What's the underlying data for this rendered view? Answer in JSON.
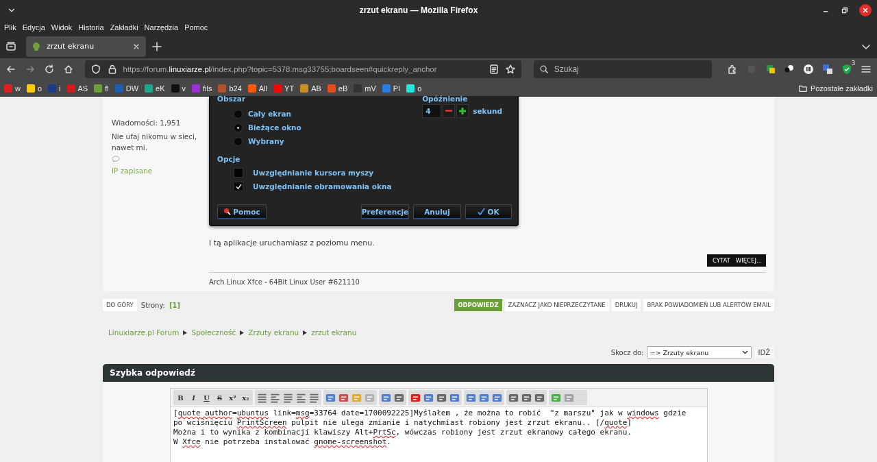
{
  "window": {
    "title": "zrzut ekranu — Mozilla Firefox"
  },
  "menu": [
    "Plik",
    "Edycja",
    "Widok",
    "Historia",
    "Zakładki",
    "Narzędzia",
    "Pomoc"
  ],
  "tabs": [
    {
      "label": "zrzut ekranu",
      "selected": true
    }
  ],
  "address": {
    "scheme": "https://forum.",
    "domain": "linuxiarze.pl",
    "path": "/index.php?topic=5378.msg33755;boardseen#quickreply_anchor"
  },
  "search": {
    "placeholder": "Szukaj"
  },
  "extension_badge": "3",
  "bookmarks": [
    {
      "label": "w",
      "color": "#e02020"
    },
    {
      "label": "o",
      "color": "#ffcc00"
    },
    {
      "label": "i",
      "color": "#1a3a8a"
    },
    {
      "label": "AS",
      "color": "#d01c1c"
    },
    {
      "label": "fl",
      "color": "#6a9f3a"
    },
    {
      "label": "DW",
      "color": "#1a5fb4"
    },
    {
      "label": "eK",
      "color": "#1aa88a"
    },
    {
      "label": "v",
      "color": "#111111"
    },
    {
      "label": "fils",
      "color": "#9b30d9"
    },
    {
      "label": "b24",
      "color": "#b0532a"
    },
    {
      "label": "All",
      "color": "#ff5a00"
    },
    {
      "label": "YT",
      "color": "#ff0000"
    },
    {
      "label": "AB",
      "color": "#c89020"
    },
    {
      "label": "eB",
      "color": "#e64a19"
    },
    {
      "label": "mV",
      "color": "#333333"
    },
    {
      "label": "PI",
      "color": "#2a7be4"
    },
    {
      "label": "o",
      "color": "#23e5db"
    }
  ],
  "other_bookmarks": "Pozostałe zakładki",
  "post": {
    "author_info": [
      "Wiadomości: 1,951",
      "Nie ufaj nikomu w sieci, nawet mi."
    ],
    "ip": "IP zapisane",
    "dialog": {
      "area_label": "Obszar",
      "areas": [
        {
          "label": "Cały ekran",
          "selected": false
        },
        {
          "label": "Bieżące okno",
          "selected": true
        },
        {
          "label": "Wybrany",
          "selected": false
        }
      ],
      "delay_label": "Opóźnienie",
      "delay_value": "4",
      "delay_unit": "sekund",
      "options_label": "Opcje",
      "options": [
        {
          "label": "Uwzględnianie kursora myszy",
          "checked": false
        },
        {
          "label": "Uwzględnianie obramowania okna",
          "checked": true
        }
      ],
      "buttons": [
        {
          "label": "Pomoc",
          "kind": "help"
        },
        {
          "label": "Preferencje",
          "kind": "plain"
        },
        {
          "label": "Anuluj",
          "kind": "plain"
        },
        {
          "label": "OK",
          "kind": "ok"
        }
      ]
    },
    "body": "I tą aplikacje uruchamiasz z poziomu menu.",
    "actions": [
      "CYTAT",
      "WIĘCEJ..."
    ],
    "signature": "Arch Linux Xfce - 64Bit Linux User #621110"
  },
  "pagination": {
    "top": "DO GÓRY",
    "pages_label": "Strony:",
    "current": "[1]",
    "actions": [
      {
        "label": "ODPOWIEDZ",
        "primary": true
      },
      {
        "label": "ZAZNACZ JAKO NIEPRZECZYTANE",
        "primary": false
      },
      {
        "label": "DRUKUJ",
        "primary": false
      },
      {
        "label": "BRAK POWIADOMIEŃ LUB ALERTÓW EMAIL",
        "primary": false
      }
    ]
  },
  "breadcrumb": [
    "Linuxiarze.pl Forum",
    "Społeczność",
    "Zrzuty ekranu",
    "zrzut ekranu"
  ],
  "jump": {
    "label": "Skocz do:",
    "value": "=> Zrzuty ekranu",
    "button": "IDŹ"
  },
  "quick_reply": {
    "title": "Szybka odpowiedź",
    "toolbar_text": [
      "B",
      "I",
      "U",
      "S",
      "x²",
      "x₂"
    ],
    "editor": [
      [
        {
          "text": "[",
          "misspelled": false
        },
        {
          "text": "quote",
          "misspelled": true
        },
        {
          "text": " author",
          "misspelled": true
        },
        {
          "text": "=",
          "misspelled": false
        },
        {
          "text": "ubuntus",
          "misspelled": true
        },
        {
          "text": " link=",
          "misspelled": false
        },
        {
          "text": "msg",
          "misspelled": true
        },
        {
          "text": "=33764 date=1700092225]Myślałem , że można to robić  \"z marszu\" jak w ",
          "misspelled": false
        },
        {
          "text": "windows",
          "misspelled": true
        },
        {
          "text": " gdzie",
          "misspelled": false
        }
      ],
      [
        {
          "text": "po wciśnięciu ",
          "misspelled": false
        },
        {
          "text": "PrintScreen",
          "misspelled": true
        },
        {
          "text": " pulpit nie ulega zmianie i natychmiast robiony jest zrzut ekranu.. [/",
          "misspelled": false
        },
        {
          "text": "quote",
          "misspelled": true
        },
        {
          "text": "]",
          "misspelled": false
        }
      ],
      [
        {
          "text": "Można i to wynika z kombinacji klawiszy Alt+",
          "misspelled": false
        },
        {
          "text": "PrtSc",
          "misspelled": true
        },
        {
          "text": ", wówczas robiony jest zrzut ekranowy całego ekranu.",
          "misspelled": false
        }
      ],
      [
        {
          "text": "W ",
          "misspelled": false
        },
        {
          "text": "Xfce",
          "misspelled": true
        },
        {
          "text": " nie potrzeba instalować ",
          "misspelled": false
        },
        {
          "text": "gnome-screenshot",
          "misspelled": true
        },
        {
          "text": ".",
          "misspelled": false
        }
      ]
    ]
  }
}
